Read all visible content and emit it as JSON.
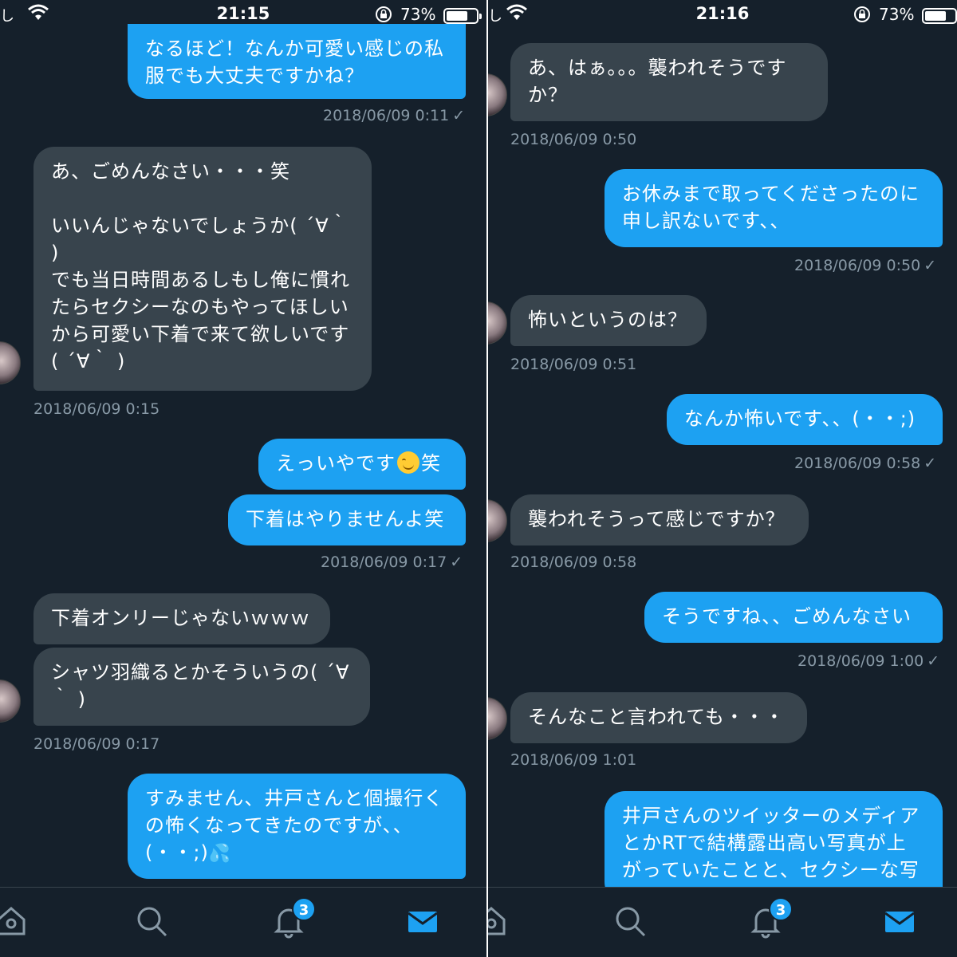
{
  "left": {
    "status": {
      "carrier": "し",
      "time": "21:15",
      "battery": "73%",
      "battery_level": 0.73
    },
    "messages": [
      {
        "text": "なるほど！なんか可愛い感じの私服でも大丈夫ですかね？",
        "dir": "out"
      },
      {
        "text": "あ、ごめんなさい・・・笑\n\nいいんじゃないでしょうか( ´∀｀ )\nでも当日時間あるしもし俺に慣れたらセクシーなのもやってほしいから可愛い下着で来て欲しいです( ´∀｀ )",
        "dir": "in"
      },
      {
        "text_a": "えっいやです",
        "text_b": "笑",
        "dir": "out"
      },
      {
        "text": "下着はやりませんよ笑",
        "dir": "out"
      },
      {
        "text": "下着オンリーじゃないｗｗｗ",
        "dir": "in"
      },
      {
        "text": "シャツ羽織るとかそういうの( ´∀｀ )",
        "dir": "in"
      },
      {
        "text": "すみません、井戸さんと個撮行くの怖くなってきたのですが、、(・・;)",
        "dir": "out"
      }
    ],
    "timestamps": [
      "2018/06/09 0:11",
      "2018/06/09 0:15",
      "2018/06/09 0:17",
      "2018/06/09 0:17"
    ],
    "check": "✓",
    "tabs": {
      "notification_count": "3"
    }
  },
  "right": {
    "status": {
      "carrier": "し",
      "time": "21:16",
      "battery": "73%",
      "battery_level": 0.73
    },
    "messages": [
      {
        "text": "あ、はぁ。。。襲われそうですか？",
        "dir": "in"
      },
      {
        "text": "お休みまで取ってくださったのに申し訳ないです、、",
        "dir": "out"
      },
      {
        "text": "怖いというのは？",
        "dir": "in"
      },
      {
        "text": "なんか怖いです、、(・・;)",
        "dir": "out"
      },
      {
        "text": "襲われそうって感じですか？",
        "dir": "in"
      },
      {
        "text": "そうですね、、ごめんなさい",
        "dir": "out"
      },
      {
        "text": "そんなこと言われても・・・",
        "dir": "in"
      },
      {
        "text": "井戸さんのツイッターのメディアとかRTで結構露出高い写真が上がっていたことと、セクシーな写",
        "dir": "out"
      }
    ],
    "timestamps": [
      "2018/06/09 0:50",
      "2018/06/09 0:50",
      "2018/06/09 0:51",
      "2018/06/09 0:58",
      "2018/06/09 0:58",
      "2018/06/09 1:00",
      "2018/06/09 1:01"
    ],
    "check": "✓",
    "tabs": {
      "notification_count": "3"
    }
  },
  "colors": {
    "background": "#15202b",
    "outgoing": "#1da1f2",
    "incoming": "#38444d",
    "timestamp": "#8899a6"
  }
}
